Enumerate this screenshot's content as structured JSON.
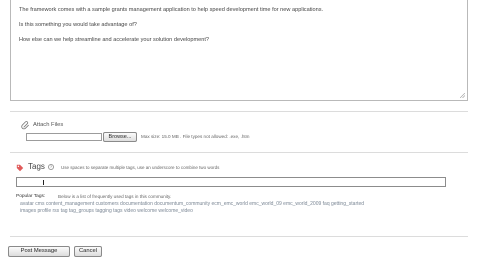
{
  "message": {
    "lines": [
      "The framework comes with a sample grants management application to help speed development time for new applications.",
      "Is this something you would take advantage of?",
      "How else can we help streamline and accelerate your solution development?"
    ]
  },
  "attachments": {
    "label": "Attach Files",
    "browse_label": "Browse...",
    "hint": "Max size: 15.0 MB . File types not allowed: .exe, .htm"
  },
  "tags": {
    "label": "Tags",
    "help": "?",
    "hint": "Use spaces to separate multiple tags, use an underscore to combine two words",
    "input_value": "",
    "popular_label": "Popular Tags:",
    "popular_desc": "Below is a list of frequently used tags in this community.",
    "popular_lines": [
      "avatar  cms  content_management  customers  documentation  documentum_community  ecm_emc_world  emc_world_09  emc_world_2009  faq  getting_started",
      "images  profile  rss  tag  tag_groups  tagging tags  video  welcome  welcome_video"
    ]
  },
  "actions": {
    "post_label": "Post Message",
    "cancel_label": "Cancel"
  },
  "colors": {
    "tag_icon": "#e05a5a",
    "popular_tag_text": "#7b8795"
  }
}
